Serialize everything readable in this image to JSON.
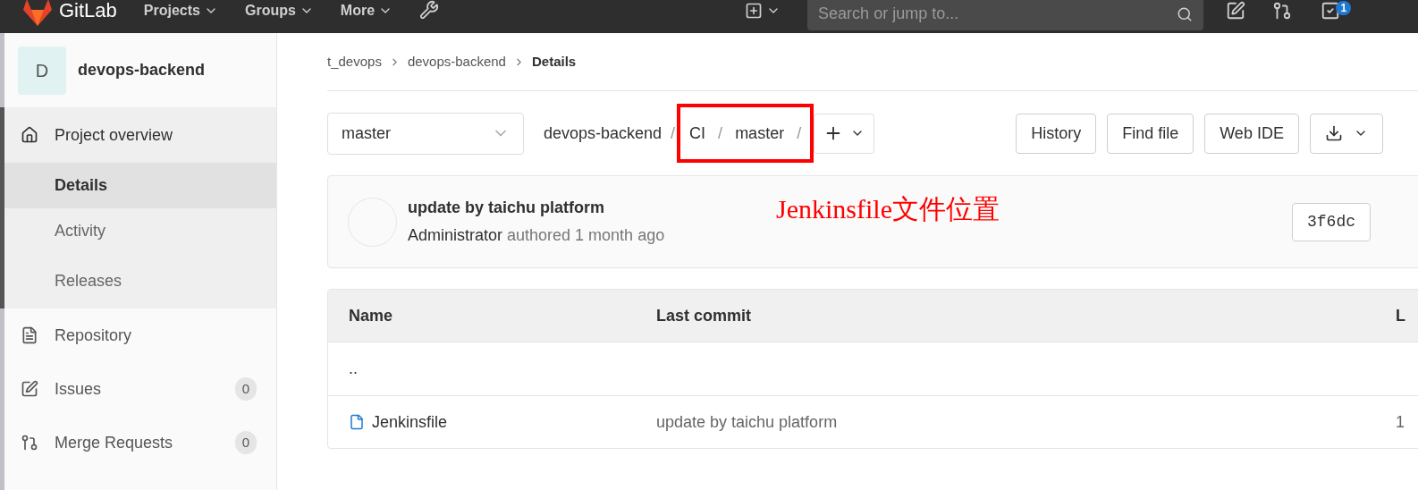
{
  "topbar": {
    "brand": "GitLab",
    "nav": [
      "Projects",
      "Groups",
      "More"
    ],
    "search": {
      "placeholder": "Search or jump to..."
    },
    "todo_count": "1"
  },
  "sidebar": {
    "project_initial": "D",
    "project_name": "devops-backend",
    "items": [
      {
        "label": "Project overview",
        "kind": "home",
        "expanded": true,
        "children": [
          {
            "label": "Details",
            "selected": true
          },
          {
            "label": "Activity",
            "selected": false
          },
          {
            "label": "Releases",
            "selected": false
          }
        ]
      },
      {
        "label": "Repository",
        "kind": "doc"
      },
      {
        "label": "Issues",
        "kind": "issues",
        "count": "0"
      },
      {
        "label": "Merge Requests",
        "kind": "merge",
        "count": "0"
      }
    ]
  },
  "breadcrumbs": [
    "t_devops",
    "devops-backend",
    "Details"
  ],
  "branch": "master",
  "path": [
    {
      "name": "devops-backend",
      "separator": "/"
    },
    {
      "name": "CI",
      "separator": "/"
    },
    {
      "name": "master",
      "separator": "/"
    }
  ],
  "actions": [
    "History",
    "Find file",
    "Web IDE"
  ],
  "commit": {
    "title": "update by taichu platform",
    "author": "Administrator",
    "when": "authored 1 month ago",
    "sha": "3f6dc"
  },
  "annotation": "Jenkinsfile文件位置",
  "table": {
    "columns": [
      "Name",
      "Last commit",
      "L"
    ],
    "rows": [
      {
        "kind": "parent",
        "name": ".."
      },
      {
        "kind": "file",
        "name": "Jenkinsfile",
        "last_commit": "update by taichu platform",
        "column_3": "1"
      }
    ]
  }
}
